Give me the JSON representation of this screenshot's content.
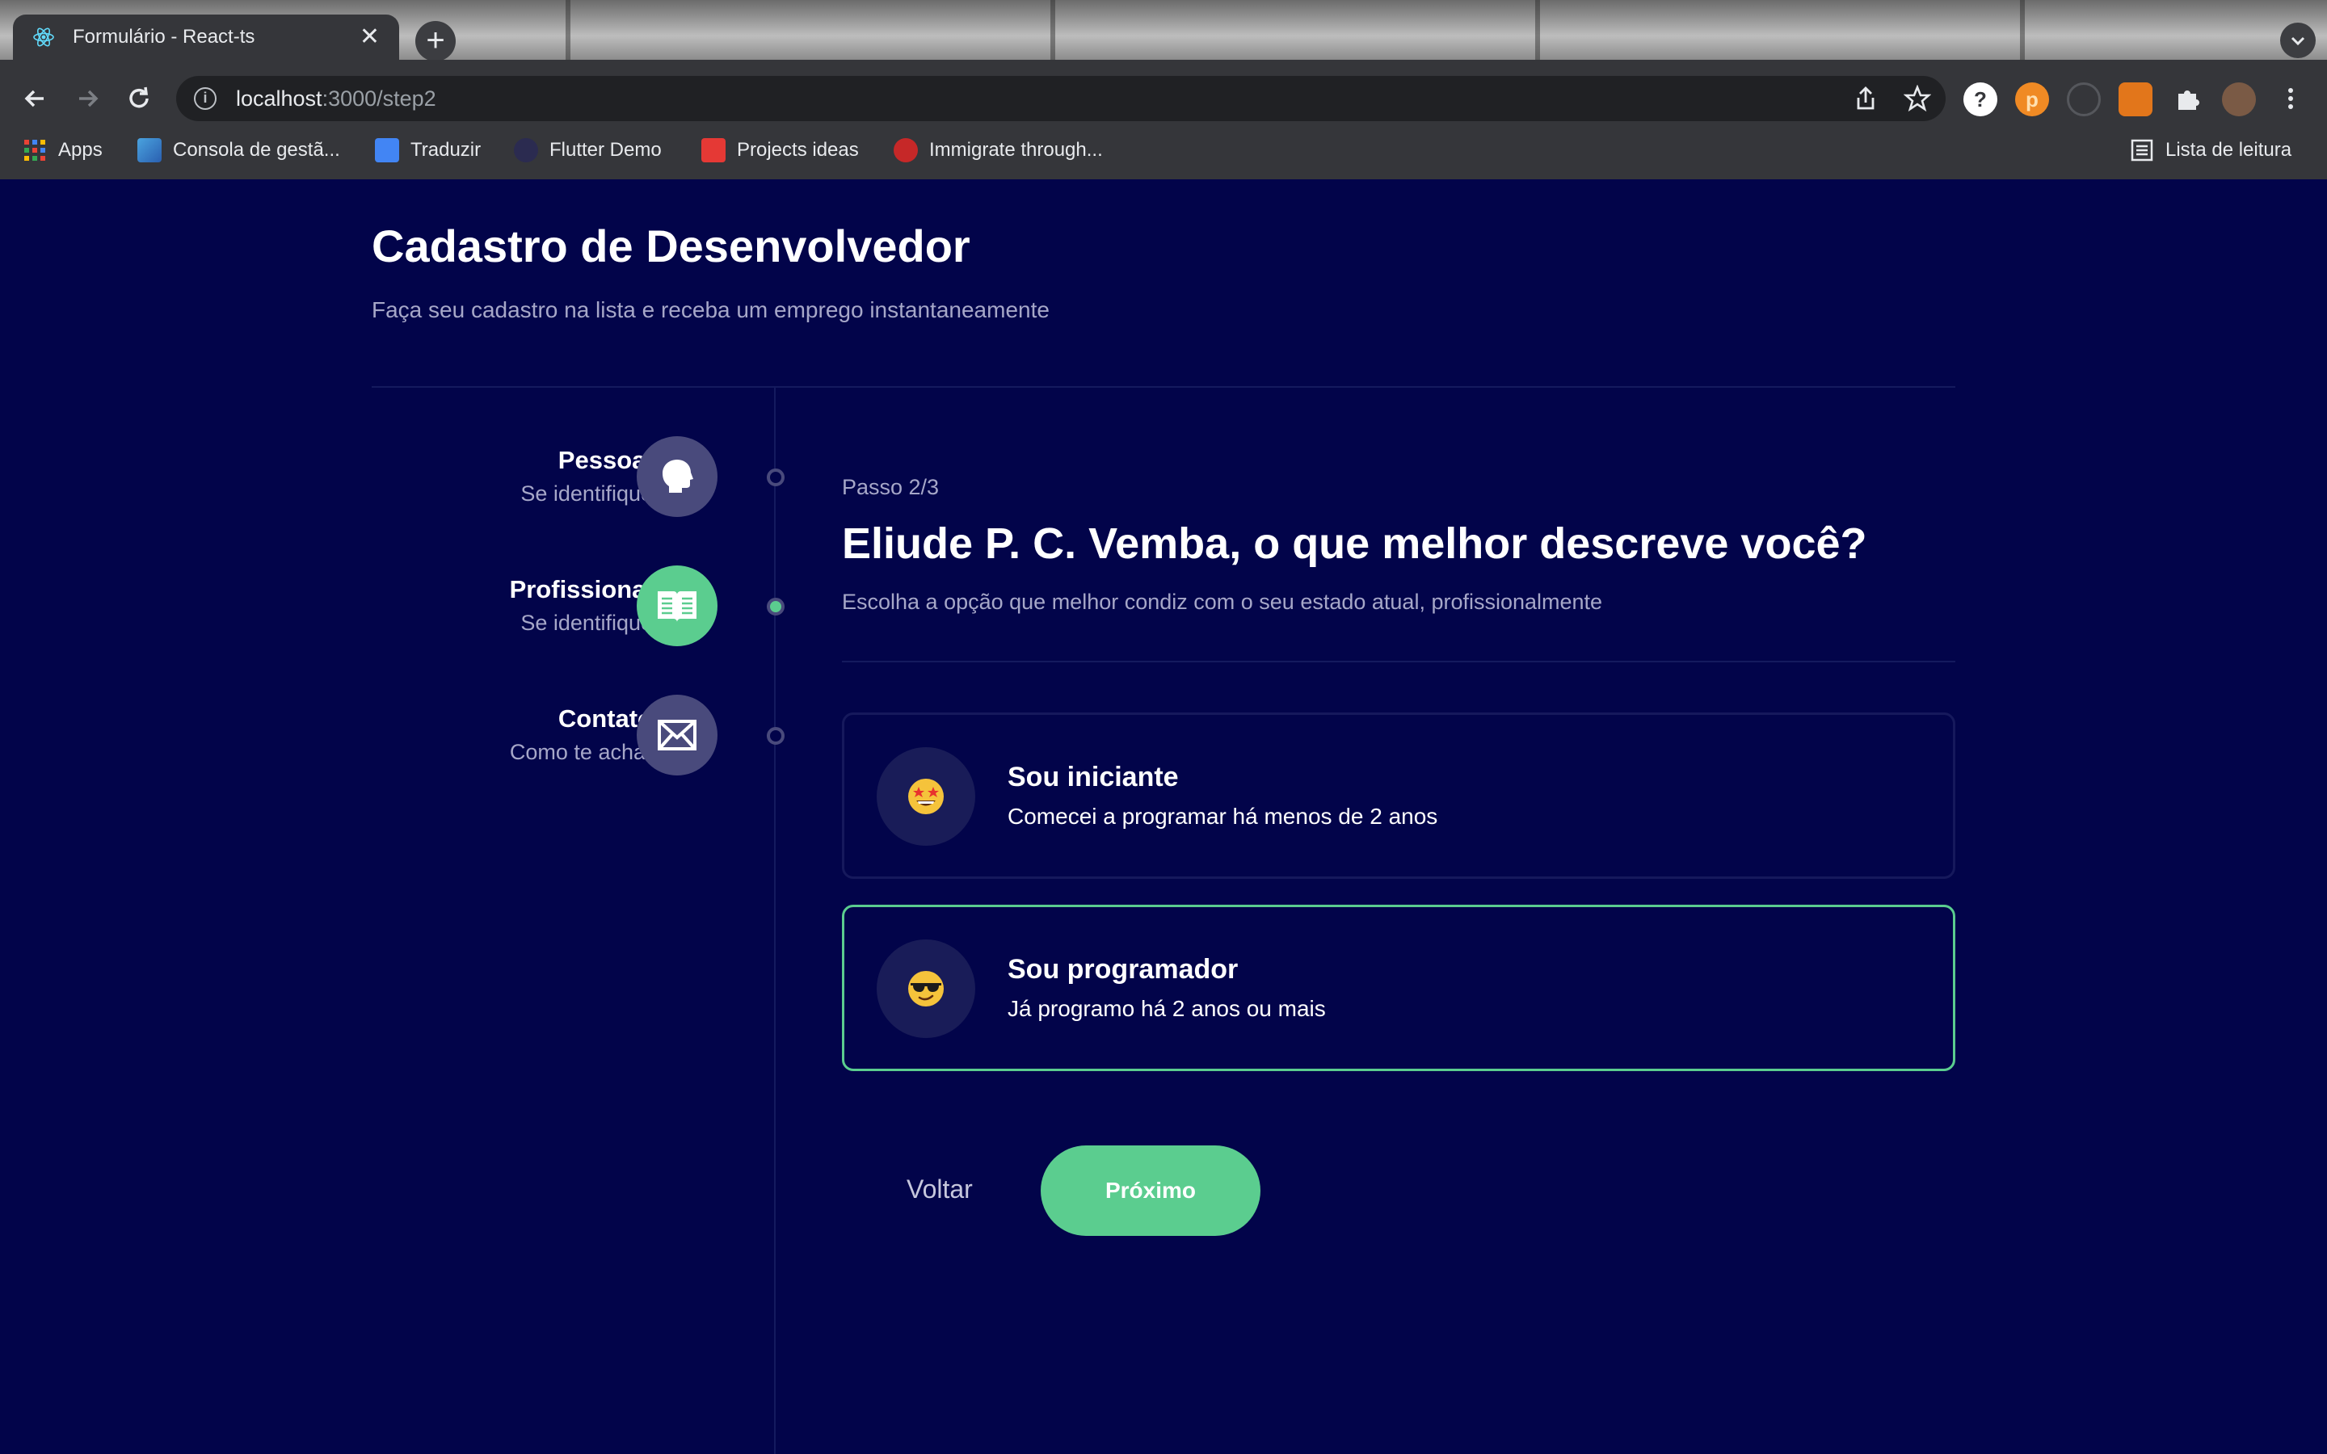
{
  "browser": {
    "tab_title": "Formulário - React-ts",
    "tab_close": "✕",
    "new_tab": "+",
    "url_host": "localhost",
    "url_path": ":3000/step2",
    "bookmarks": [
      {
        "label": "Apps",
        "icon": "apps-grid-icon"
      },
      {
        "label": "Consola de gestã...",
        "icon": "console-icon"
      },
      {
        "label": "Traduzir",
        "icon": "translate-icon"
      },
      {
        "label": "Flutter Demo",
        "icon": "flutter-icon"
      },
      {
        "label": "Projects ideas",
        "icon": "bookmark-icon"
      },
      {
        "label": "Immigrate through...",
        "icon": "maple-leaf-icon"
      }
    ],
    "reading_list": "Lista de leitura"
  },
  "header": {
    "title": "Cadastro de Desenvolvedor",
    "subtitle": "Faça seu cadastro na lista e receba um emprego instantaneamente"
  },
  "steps": [
    {
      "title": "Pessoal",
      "desc": "Se identifique",
      "icon": "person-head-icon",
      "active": false
    },
    {
      "title": "Profissional",
      "desc": "Se identifique",
      "icon": "book-icon",
      "active": true
    },
    {
      "title": "Contato",
      "desc": "Como te achar",
      "icon": "envelope-icon",
      "active": false
    }
  ],
  "form": {
    "step_label": "Passo 2/3",
    "question": "Eliude P. C. Vemba, o que melhor descreve você?",
    "question_sub": "Escolha a opção que melhor condiz com o seu estado atual, profissionalmente",
    "options": [
      {
        "title": "Sou iniciante",
        "desc": "Comecei a programar há menos de 2 anos",
        "emoji": "🤩",
        "selected": false
      },
      {
        "title": "Sou programador",
        "desc": "Já programo há 2 anos ou mais",
        "emoji": "😎",
        "selected": true
      }
    ],
    "back_label": "Voltar",
    "next_label": "Próximo"
  },
  "colors": {
    "background": "#02044a",
    "accent": "#5bcd8f",
    "step_inactive": "#494a7c",
    "muted_text": "#a6a7c8"
  }
}
